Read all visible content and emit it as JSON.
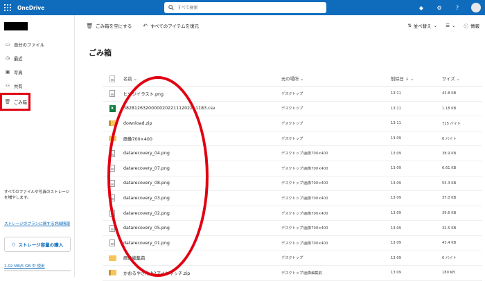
{
  "header": {
    "app_name": "OneDrive",
    "search_placeholder": "すべて検索",
    "icons": [
      "diamond-icon",
      "settings-icon",
      "help-icon",
      "avatar"
    ]
  },
  "sidebar": {
    "items": [
      {
        "label": "自分のファイル",
        "icon": "folder-icon"
      },
      {
        "label": "最近",
        "icon": "clock-icon"
      },
      {
        "label": "写真",
        "icon": "photo-icon"
      },
      {
        "label": "共有",
        "icon": "people-icon"
      },
      {
        "label": "ごみ箱",
        "icon": "trash-icon",
        "active": true
      }
    ],
    "storage_text": "すべてのファイルや写真のストレージを増やします。",
    "storage_link": "ストレージのプランに関する詳細情報",
    "buy_button": "ストレージ容量の購入",
    "used": "1.02 MB/5 GB 中 使用"
  },
  "toolbar": {
    "empty_bin": "ごみ箱を空にする",
    "restore_all": "すべてのアイテムを復元",
    "sort": "並べ替え",
    "info": "情報"
  },
  "page": {
    "title": "ごみ箱"
  },
  "table": {
    "headers": {
      "name": "名前",
      "location": "元の場所",
      "deleted": "削除日",
      "size": "サイズ"
    },
    "rows": [
      {
        "type": "png",
        "name": "ヒツジイラスト.png",
        "location": "デスクトップ",
        "deleted": "13:11",
        "size": "43.8 KB"
      },
      {
        "type": "csv",
        "name": "382812632000002022111202211183.csv",
        "location": "デスクトップ",
        "deleted": "13:11",
        "size": "1.18 KB"
      },
      {
        "type": "zip",
        "name": "download.zip",
        "location": "デスクトップ",
        "deleted": "13:11",
        "size": "715 バイト"
      },
      {
        "type": "folder",
        "name": "画像700×400",
        "location": "デスクトップ",
        "deleted": "13:09",
        "size": "0 バイト"
      },
      {
        "type": "png",
        "name": "datarecovery_04.png",
        "location": "デスクトップ/画像700×400",
        "deleted": "13:09",
        "size": "38.9 KB"
      },
      {
        "type": "png",
        "name": "datarecovery_07.png",
        "location": "デスクトップ/画像700×400",
        "deleted": "13:09",
        "size": "6.61 KB"
      },
      {
        "type": "png",
        "name": "datarecovery_08.png",
        "location": "デスクトップ/画像700×400",
        "deleted": "13:09",
        "size": "55.3 KB"
      },
      {
        "type": "png",
        "name": "datarecovery_03.png",
        "location": "デスクトップ/画像700×400",
        "deleted": "13:09",
        "size": "37.0 KB"
      },
      {
        "type": "png",
        "name": "datarecovery_02.png",
        "location": "デスクトップ/画像700×400",
        "deleted": "13:09",
        "size": "39.6 KB"
      },
      {
        "type": "png",
        "name": "datarecovery_05.png",
        "location": "デスクトップ/画像700×400",
        "deleted": "13:09",
        "size": "32.5 KB"
      },
      {
        "type": "png",
        "name": "datarecovery_01.png",
        "location": "デスクトップ/画像700×400",
        "deleted": "13:09",
        "size": "43.4 KB"
      },
      {
        "type": "folder",
        "name": "画像編集前",
        "location": "デスクトップ",
        "deleted": "13:09",
        "size": "0 バイト"
      },
      {
        "type": "zip",
        "name": "かおるやさん.h2アイキャッチ.zip",
        "location": "デスクトップ/画像編集前",
        "deleted": "13:09",
        "size": "180 KB"
      }
    ]
  },
  "colors": {
    "brand": "#0f6cbd",
    "highlight": "#e00012"
  }
}
